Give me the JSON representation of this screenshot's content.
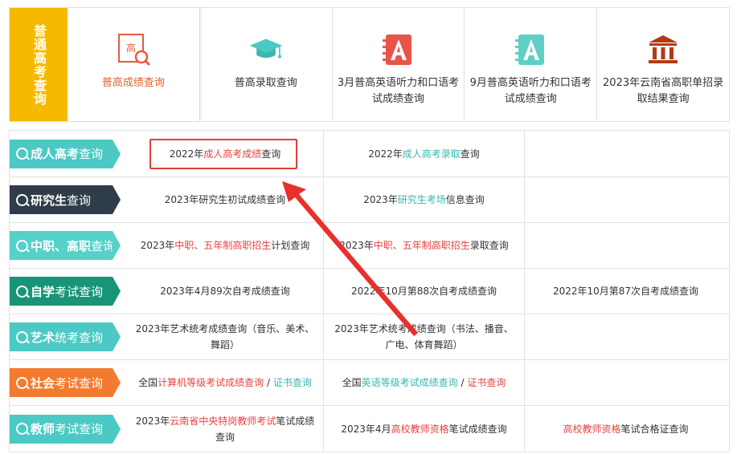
{
  "top": {
    "label": "普通高考查询",
    "icon_glyph": "高",
    "items": [
      {
        "label": "普高成绩查询",
        "icon": "search-doc-icon"
      },
      {
        "label": "普高录取查询",
        "icon": "graduation-cap-icon"
      },
      {
        "label": "3月普高英语听力和口语考试成绩查询",
        "icon": "letter-a-book-icon"
      },
      {
        "label": "9月普高英语听力和口语考试成绩查询",
        "icon": "letter-a-book-icon"
      },
      {
        "label": "2023年云南省高职单招录取结果查询",
        "icon": "building-icon"
      }
    ]
  },
  "categories": [
    {
      "bold": "成人高考",
      "lite": "查询",
      "color": "#4cc9c4"
    },
    {
      "bold": "研究生",
      "lite": "查询",
      "color": "#2f3d49"
    },
    {
      "bold": "中职、高职",
      "lite": "查询",
      "color": "#56d1c8"
    },
    {
      "bold": "自学",
      "lite": "考试查询",
      "color": "#189477"
    },
    {
      "bold": "艺术",
      "lite": "统考查询",
      "color": "#4cc9c4"
    },
    {
      "bold": "社会",
      "lite": "考试查询",
      "color": "#f37b2f"
    },
    {
      "bold": "教师",
      "lite": "考试查询",
      "color": "#4cc9c4"
    }
  ],
  "cells": {
    "r1c1": {
      "a": "2022年",
      "b": "成人高考成绩",
      "c": "查询"
    },
    "r1c2": {
      "a": "2022年",
      "b": "成人高考录取",
      "c": "查询"
    },
    "r2c1": {
      "a": "2023年研究生初试成绩查询"
    },
    "r2c2": {
      "a": "2023年",
      "b": "研究生考场",
      "c": "信息查询"
    },
    "r3c1": {
      "a": "2023年",
      "b": "中职、五年制高职招生",
      "c": "计划查询"
    },
    "r3c2": {
      "a": "2023年",
      "b": "中职、五年制高职招生",
      "c": "录取查询"
    },
    "r4c1": {
      "a": "2023年4月89次自考成绩查询"
    },
    "r4c2": {
      "a": "2022年10月第88次自考成绩查询"
    },
    "r4c3": {
      "a": "2022年10月第87次自考成绩查询"
    },
    "r5c1": {
      "a": "2023年艺术统考成绩查询（音乐、美术、舞蹈）"
    },
    "r5c2": {
      "a": "2023年艺术统考成绩查询（书法、播音、广电、体育舞蹈）"
    },
    "r6c1": {
      "a": "全国",
      "b": "计算机等级考试成绩查询",
      "sep": " / ",
      "d": "证书查询"
    },
    "r6c2": {
      "a": "全国",
      "b": "英语等级考试成绩查询",
      "sep": " / ",
      "d": "证书查询"
    },
    "r7c1": {
      "a": "2023年",
      "b": "云南省中央特岗教师考试",
      "c": "笔试成绩查询"
    },
    "r7c2": {
      "a": "2023年4月",
      "b": "高校教师资格",
      "c": "笔试成绩查询"
    },
    "r7c3": {
      "b": "高校教师资格",
      "c": "笔试合格证查询"
    }
  },
  "colors": {
    "top_label_bg": "#f7b900",
    "active_orange": "#e0622a",
    "link_red": "#e64340",
    "link_teal": "#35b8b0",
    "annotation_red": "#e43e36"
  }
}
